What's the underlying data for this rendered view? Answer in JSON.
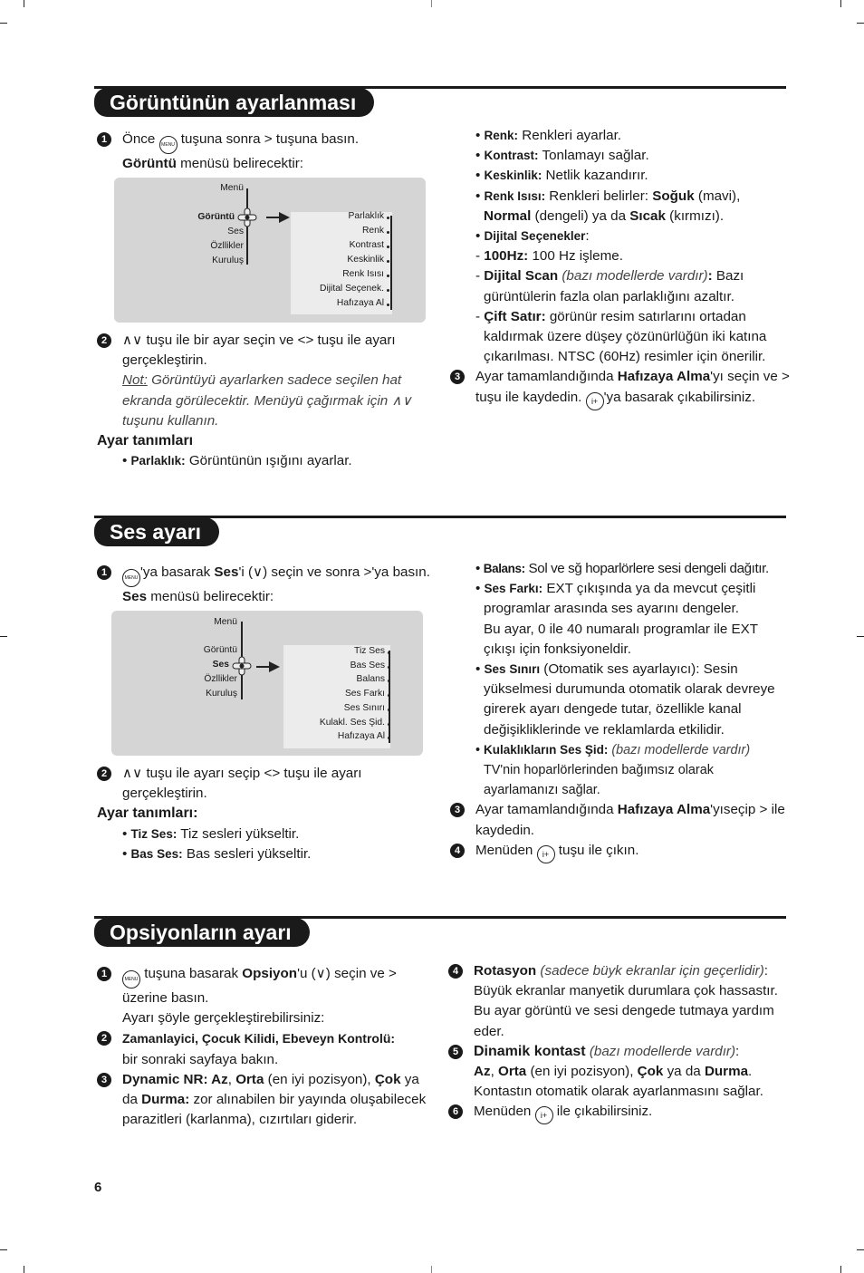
{
  "page_number": "6",
  "sections": {
    "picture": {
      "title": "Görüntünün ayarlanması",
      "step1": {
        "num": "1",
        "a": "Önce ",
        "menu_icon": "MENU",
        "b": " tuşuna sonra > tuşuna basın.",
        "c_bold": "Görüntü",
        "c": " menüsü belirecektir:"
      },
      "diagram": {
        "main_menu": [
          "Menü",
          "Görüntü",
          "Ses",
          "Özllikler",
          "Kuruluş"
        ],
        "selected": "Görüntü",
        "submenu": [
          "Parlaklık",
          "Renk",
          "Kontrast",
          "Keskinlik",
          "Renk Isısı",
          "Dijital Seçenek.",
          "Hafızaya Al"
        ]
      },
      "step2": {
        "num": "2",
        "text": "∧∨ tuşu ile bir ayar seçin ve <> tuşu ile ayarı gerçekleştirin.",
        "note_label": "Not:",
        "note": " Görüntüyü ayarlarken sadece seçilen hat ekranda görülecektir. Menüyü çağırmak için ∧∨ tuşunu kullanın."
      },
      "defs_heading": "Ayar tanımları",
      "defs": [
        {
          "term": "Parlaklık:",
          "desc": " Görüntünün ışığını ayarlar."
        },
        {
          "term": "Renk:",
          "desc": " Renkleri ayarlar."
        },
        {
          "term": "Kontrast:",
          "desc": " Tonlamayı sağlar."
        },
        {
          "term": "Keskinlik:",
          "desc": " Netlik kazandırır."
        }
      ],
      "renk_isisi": {
        "term": "Renk Isısı:",
        "a": " Renkleri belirler: ",
        "soguk": "Soğuk",
        "b": " (mavi),",
        "normal": "Normal",
        "c": " (dengeli) ya da ",
        "sicak": "Sıcak",
        "d": " (kırmızı)."
      },
      "dijital": {
        "term": "Dijital Seçenekler",
        "colon": ":"
      },
      "hz100": {
        "term": "100Hz:",
        "desc": " 100 Hz işleme."
      },
      "dscan": {
        "term": "Dijital Scan",
        "note": " (bazı modellerde vardır)",
        "colon": ":",
        "desc": " Bazı gürüntülerin fazla olan parlaklığını azaltır."
      },
      "cift": {
        "term": "Çift Satır:",
        "desc": " görünür resim satırlarını ortadan kaldırmak üzere düşey çözünürlüğün iki katına çıkarılması. NTSC (60Hz) resimler için önerilir."
      },
      "step3": {
        "num": "3",
        "a": "Ayar tamamlandığında ",
        "bold": "Hafızaya Alma",
        "b": "'yı seçin ve > tuşu ile kaydedin. ",
        "exit_icon": "i+",
        "c": "'ya basarak çıkabilirsiniz."
      }
    },
    "sound": {
      "title": "Ses ayarı",
      "step1": {
        "num": "1",
        "menu_icon": "MENU",
        "a": "'ya basarak ",
        "bold": "Ses",
        "b": "'i (∨) seçin ve sonra >'ya basın. ",
        "bold2": "Ses",
        "c": " menüsü belirecektir:"
      },
      "diagram": {
        "main_menu": [
          "Menü",
          "Görüntü",
          "Ses",
          "Özllikler",
          "Kuruluş"
        ],
        "selected": "Ses",
        "submenu": [
          "Tiz Ses",
          "Bas Ses",
          "Balans",
          "Ses Farkı",
          "Ses Sınırı",
          "Kulakl. Ses Şid.",
          "Hafızaya Al"
        ]
      },
      "step2": {
        "num": "2",
        "text": "∧∨ tuşu ile ayarı seçip <> tuşu ile ayarı gerçekleştirin."
      },
      "defs_heading": "Ayar tanımları:",
      "defs": [
        {
          "term": "Tiz Ses:",
          "desc": " Tiz sesleri yükseltir."
        },
        {
          "term": "Bas Ses:",
          "desc": " Bas sesleri yükseltir."
        }
      ],
      "balans": {
        "term": "Balans:",
        "desc": " Sol ve sğ hoparlörlere sesi dengeli dağıtır."
      },
      "ses_farki": {
        "term": "Ses Farkı:",
        "desc": " EXT çıkışında ya da mevcut çeşitli programlar arasında ses ayarını dengeler.",
        "desc2": "Bu ayar, 0 ile 40 numaralı programlar ile EXT çıkışı için fonksiyoneldir."
      },
      "ses_siniri": {
        "term": "Ses Sınırı",
        "desc": " (Otomatik ses ayarlayıcı): Sesin yükselmesi durumunda otomatik olarak devreye girerek ayarı dengede tutar, özellikle kanal değişikliklerinde ve reklamlarda etkilidir."
      },
      "kulaklik": {
        "term": "Kulaklıkların Ses Şid:",
        "note": " (bazı modellerde vardır)",
        "desc": "TV'nin hoparlörlerinden bağımsız olarak ayarlamanızı sağlar."
      },
      "step3": {
        "num": "3",
        "a": "Ayar tamamlandığında ",
        "bold": "Hafızaya Alma",
        "b": "'yıseçip > ile kaydedin."
      },
      "step4": {
        "num": "4",
        "a": "Menüden ",
        "exit_icon": "i+",
        "b": " tuşu ile çıkın."
      }
    },
    "options": {
      "title": "Opsiyonların ayarı",
      "step1": {
        "num": "1",
        "menu_icon": "MENU",
        "a": " tuşuna basarak ",
        "bold": "Opsiyon",
        "b": "'u (∨) seçin ve > üzerine basın.",
        "c": "Ayarı şöyle gerçekleştirebilirsiniz:"
      },
      "step2": {
        "num": "2",
        "bold": "Zamanlayici, Çocuk Kilidi, Ebeveyn Kontrolü:",
        "text": "bir sonraki sayfaya bakın."
      },
      "step3": {
        "num": "3",
        "b1": "Dynamic NR: Az",
        "t1": ", ",
        "b2": "Orta",
        "t2": " (en iyi pozisyon), ",
        "b3": "Çok",
        "t3": " ya da ",
        "b4": "Durma:",
        "t4": " zor alınabilen bir yayında oluşabilecek parazitleri (karlanma), cızırtıları giderir."
      },
      "step4": {
        "num": "4",
        "bold": "Rotasyon",
        "note": " (sadece büyk ekranlar için geçerlidir)",
        "colon": ":",
        "text": "Büyük ekranlar manyetik durumlara çok hassastır. Bu ayar görüntü ve sesi dengede tutmaya yardım eder."
      },
      "step5": {
        "num": "5",
        "bold": "Dinamik kontast",
        "note": " (bazı modellerde vardır)",
        "colon": ":",
        "b1": "Az",
        "t1": ", ",
        "b2": "Orta",
        "t2": " (en iyi pozisyon), ",
        "b3": "Çok",
        "t3": " ya da ",
        "b4": "Durma",
        "t4": ".",
        "text": "Kontastın otomatik olarak ayarlanmasını sağlar."
      },
      "step6": {
        "num": "6",
        "a": "Menüden ",
        "exit_icon": "i+",
        "b": " ile çıkabilirsiniz."
      }
    }
  }
}
